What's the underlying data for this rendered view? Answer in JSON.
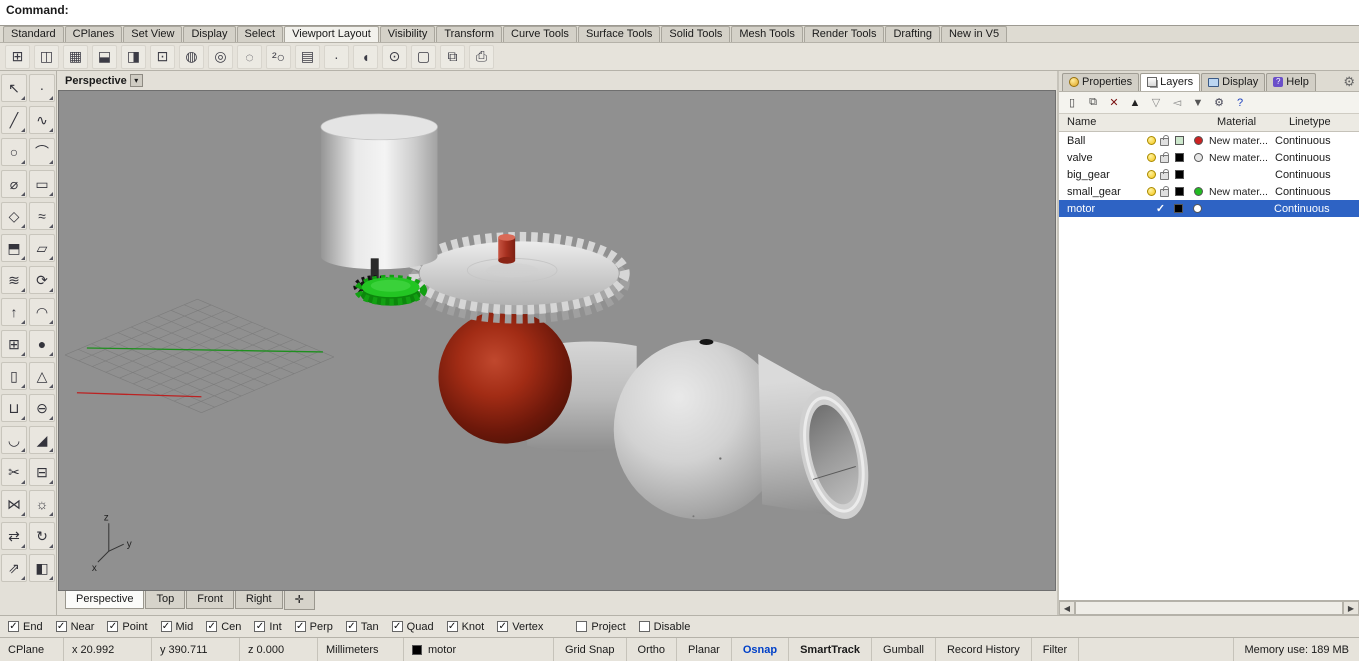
{
  "colors": {
    "selection_blue": "#2e63c4",
    "accent_blue": "#0040c8",
    "viewport_bg": "#909090",
    "window_bg": "#e3e0d8"
  },
  "command_bar": {
    "prompt": "Command:"
  },
  "menu_tabs": {
    "items": [
      {
        "label": "Standard"
      },
      {
        "label": "CPlanes"
      },
      {
        "label": "Set View"
      },
      {
        "label": "Display"
      },
      {
        "label": "Select"
      },
      {
        "label": "Viewport Layout",
        "active": true
      },
      {
        "label": "Visibility"
      },
      {
        "label": "Transform"
      },
      {
        "label": "Curve Tools"
      },
      {
        "label": "Surface Tools"
      },
      {
        "label": "Solid Tools"
      },
      {
        "label": "Mesh Tools"
      },
      {
        "label": "Render Tools"
      },
      {
        "label": "Drafting"
      },
      {
        "label": "New in V5"
      }
    ]
  },
  "top_toolbar": {
    "icons": [
      {
        "icon": "standard-viewports-icon",
        "glyph": "⊞"
      },
      {
        "icon": "four-viewports-icon",
        "glyph": "◫"
      },
      {
        "icon": "viewport-grid-icon",
        "glyph": "▦"
      },
      {
        "icon": "split-horizontal-icon",
        "glyph": "⬓"
      },
      {
        "icon": "split-vertical-icon",
        "glyph": "◨"
      },
      {
        "icon": "maximize-viewport-icon",
        "glyph": "⊡"
      },
      {
        "icon": "shaded-viewport-icon",
        "glyph": "◍"
      },
      {
        "icon": "rendered-viewport-icon",
        "glyph": "◎"
      },
      {
        "icon": "zoom-lens-icon",
        "glyph": "◌"
      },
      {
        "icon": "zoom-2d-icon",
        "glyph": "²○"
      },
      {
        "icon": "grid-toggle-icon",
        "glyph": "▤"
      },
      {
        "icon": "point-display-icon",
        "glyph": "∙"
      },
      {
        "icon": "arc-view-icon",
        "glyph": "◖"
      },
      {
        "icon": "camera-icon",
        "glyph": "⊙"
      },
      {
        "icon": "page-layout-icon",
        "glyph": "▢"
      },
      {
        "icon": "named-views-icon",
        "glyph": "⧉"
      },
      {
        "icon": "print-icon",
        "glyph": "⎙"
      }
    ]
  },
  "left_toolbar": {
    "icons": [
      {
        "icon": "select-icon",
        "glyph": "↖"
      },
      {
        "icon": "point-icon",
        "glyph": "∙"
      },
      {
        "icon": "line-icon",
        "glyph": "╱"
      },
      {
        "icon": "curve-icon",
        "glyph": "∿"
      },
      {
        "icon": "circle-icon",
        "glyph": "○"
      },
      {
        "icon": "arc-icon",
        "glyph": "⌒"
      },
      {
        "icon": "ellipse-icon",
        "glyph": "⌀"
      },
      {
        "icon": "rectangle-icon",
        "glyph": "▭"
      },
      {
        "icon": "polygon-icon",
        "glyph": "◇"
      },
      {
        "icon": "curve-tools-icon",
        "glyph": "≈"
      },
      {
        "icon": "surface-icon",
        "glyph": "⬒"
      },
      {
        "icon": "plane-icon",
        "glyph": "▱"
      },
      {
        "icon": "loft-icon",
        "glyph": "≋"
      },
      {
        "icon": "revolve-icon",
        "glyph": "⟳"
      },
      {
        "icon": "extrude-icon",
        "glyph": "↑"
      },
      {
        "icon": "sweep-icon",
        "glyph": "◠"
      },
      {
        "icon": "box-icon",
        "glyph": "⊞"
      },
      {
        "icon": "sphere-icon",
        "glyph": "●"
      },
      {
        "icon": "cylinder-icon",
        "glyph": "▯"
      },
      {
        "icon": "cone-icon",
        "glyph": "△"
      },
      {
        "icon": "boolean-union-icon",
        "glyph": "⊔"
      },
      {
        "icon": "boolean-difference-icon",
        "glyph": "⊖"
      },
      {
        "icon": "fillet-icon",
        "glyph": "◡"
      },
      {
        "icon": "chamfer-icon",
        "glyph": "◢"
      },
      {
        "icon": "trim-icon",
        "glyph": "✂"
      },
      {
        "icon": "split-icon",
        "glyph": "⊟"
      },
      {
        "icon": "join-icon",
        "glyph": "⋈"
      },
      {
        "icon": "explode-icon",
        "glyph": "☼"
      },
      {
        "icon": "move-icon",
        "glyph": "⇄"
      },
      {
        "icon": "rotate-icon",
        "glyph": "↻"
      },
      {
        "icon": "scale-icon",
        "glyph": "⇗"
      },
      {
        "icon": "mirror-icon",
        "glyph": "◧"
      }
    ]
  },
  "viewport": {
    "title": "Perspective",
    "menu_arrow": "▾",
    "axis_labels": {
      "x": "x",
      "y": "y",
      "z": "z"
    },
    "tabs": [
      {
        "label": "Perspective",
        "active": true
      },
      {
        "label": "Top"
      },
      {
        "label": "Front"
      },
      {
        "label": "Right"
      },
      {
        "label": "✛",
        "icon": "new-viewport-tab-button"
      }
    ]
  },
  "right_panel": {
    "tabs": {
      "properties": "Properties",
      "layers": "Layers",
      "display": "Display",
      "help": "Help"
    },
    "gear_glyph": "⚙",
    "check_glyph": "✓",
    "toolbar_icons": [
      {
        "icon": "new-layer-icon",
        "glyph": "▯",
        "color": "#444444"
      },
      {
        "icon": "new-sublayer-icon",
        "glyph": "⧉",
        "color": "#444444"
      },
      {
        "icon": "delete-layer-icon",
        "glyph": "✕",
        "color": "#7a1010"
      },
      {
        "icon": "move-up-icon",
        "glyph": "▲",
        "color": "#222222"
      },
      {
        "icon": "move-down-icon",
        "glyph": "▽",
        "color": "#888888"
      },
      {
        "icon": "match-layer-icon",
        "glyph": "◅",
        "color": "#888888"
      },
      {
        "icon": "filter-icon",
        "glyph": "▼",
        "color": "#555555"
      },
      {
        "icon": "layer-tools-icon",
        "glyph": "⚙",
        "color": "#444455"
      },
      {
        "icon": "help-icon",
        "glyph": "?",
        "color": "#1a3fbf"
      }
    ],
    "columns": {
      "name": "Name",
      "material": "Material",
      "linetype": "Linetype"
    },
    "layers": [
      {
        "name": "Ball",
        "swatch": "#cde8cd",
        "material_color": "#cc2222",
        "material": "New mater...",
        "linetype": "Continuous"
      },
      {
        "name": "valve",
        "swatch": "#000000",
        "material_color": "#e6e6e6",
        "material": "New mater...",
        "linetype": "Continuous"
      },
      {
        "name": "big_gear",
        "swatch": "#000000",
        "material": "",
        "linetype": "Continuous",
        "nomat": true
      },
      {
        "name": "small_gear",
        "swatch": "#000000",
        "material_color": "#22bb22",
        "material": "New mater...",
        "linetype": "Continuous"
      },
      {
        "name": "motor",
        "swatch": "#000000",
        "material_color": "#ffffff",
        "material": "",
        "linetype": "Continuous",
        "selected": true,
        "current": true
      }
    ],
    "scroll": {
      "left": "◀",
      "right": "▶"
    }
  },
  "osnap": {
    "items": [
      {
        "label": "End",
        "checked": true
      },
      {
        "label": "Near",
        "checked": true
      },
      {
        "label": "Point",
        "checked": true
      },
      {
        "label": "Mid",
        "checked": true
      },
      {
        "label": "Cen",
        "checked": true
      },
      {
        "label": "Int",
        "checked": true
      },
      {
        "label": "Perp",
        "checked": true
      },
      {
        "label": "Tan",
        "checked": true
      },
      {
        "label": "Quad",
        "checked": true
      },
      {
        "label": "Knot",
        "checked": true
      },
      {
        "label": "Vertex",
        "checked": true
      },
      {
        "label": "Project"
      },
      {
        "label": "Disable"
      }
    ]
  },
  "status_bar": {
    "cplane": "CPlane",
    "x": "x 20.992",
    "y": "y 390.711",
    "z": "z 0.000",
    "units": "Millimeters",
    "layer": "motor",
    "toggles": [
      {
        "label": "Grid Snap"
      },
      {
        "label": "Ortho"
      },
      {
        "label": "Planar"
      },
      {
        "label": "Osnap",
        "accent": true
      },
      {
        "label": "SmartTrack",
        "bold": true
      },
      {
        "label": "Gumball"
      },
      {
        "label": "Record History"
      },
      {
        "label": "Filter"
      }
    ],
    "memory": "Memory use: 189 MB"
  },
  "scene": {
    "cylinder_color": "#e8e8e8",
    "gear_color": "#d4d4d4",
    "small_gear_color": "#1fc01f",
    "ball_color": "#a22c15",
    "valve_color": "#c6c6c6",
    "knob_color": "#b0392a",
    "x_axis_color": "#bb2222",
    "y_axis_color": "#1e8f1e"
  }
}
